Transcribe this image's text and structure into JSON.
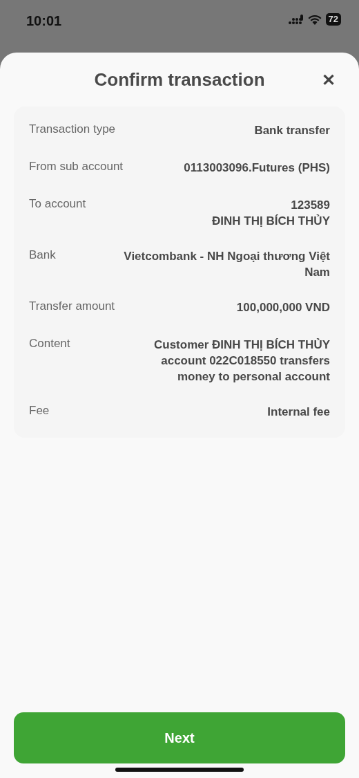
{
  "status_bar": {
    "time": "10:01",
    "battery": "72"
  },
  "sheet": {
    "title": "Confirm transaction",
    "close": "✕"
  },
  "details": [
    {
      "label": "Transaction type",
      "value": "Bank transfer"
    },
    {
      "label": "From sub account",
      "value": "0113003096.Futures (PHS)"
    },
    {
      "label": "To account",
      "value": "123589\nĐINH THỊ BÍCH THỦY"
    },
    {
      "label": "Bank",
      "value": "Vietcombank - NH Ngoại thương Việt\nNam"
    },
    {
      "label": "Transfer amount",
      "value": "100,000,000 VND"
    },
    {
      "label": "Content",
      "value": "Customer ĐINH THỊ BÍCH THỦY\naccount 022C018550 transfers\nmoney to personal account"
    },
    {
      "label": "Fee",
      "value": "Internal fee"
    }
  ],
  "buttons": [
    {
      "label": "Next"
    }
  ]
}
